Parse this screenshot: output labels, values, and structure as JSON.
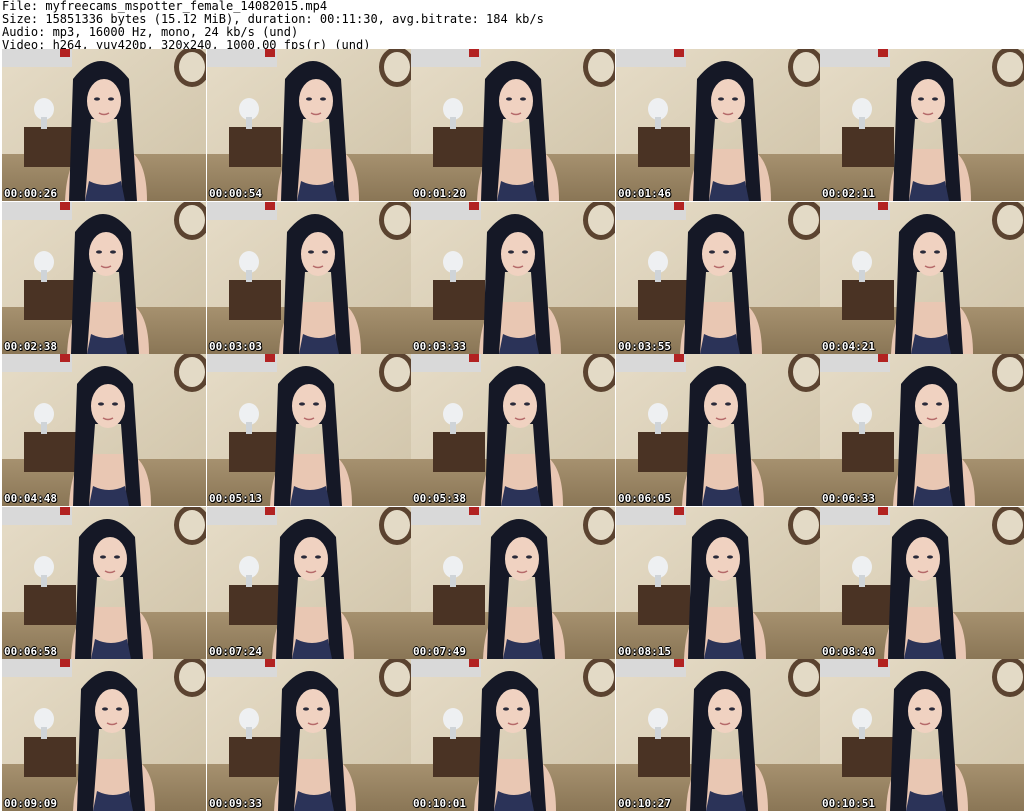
{
  "info": {
    "file": "File: myfreecams_mspotter_female_14082015.mp4",
    "size": "Size: 15851336 bytes (15.12 MiB), duration: 00:11:30, avg.bitrate: 184 kb/s",
    "audio": "Audio: mp3, 16000 Hz, mono, 24 kb/s (und)",
    "video": "Video: h264, yuv420p, 320x240, 1000.00 fps(r) (und)"
  },
  "thumbnails": [
    {
      "timestamp": "00:00:26"
    },
    {
      "timestamp": "00:00:54"
    },
    {
      "timestamp": "00:01:20"
    },
    {
      "timestamp": "00:01:46"
    },
    {
      "timestamp": "00:02:11"
    },
    {
      "timestamp": "00:02:38"
    },
    {
      "timestamp": "00:03:03"
    },
    {
      "timestamp": "00:03:33"
    },
    {
      "timestamp": "00:03:55"
    },
    {
      "timestamp": "00:04:21"
    },
    {
      "timestamp": "00:04:48"
    },
    {
      "timestamp": "00:05:13"
    },
    {
      "timestamp": "00:05:38"
    },
    {
      "timestamp": "00:06:05"
    },
    {
      "timestamp": "00:06:33"
    },
    {
      "timestamp": "00:06:58"
    },
    {
      "timestamp": "00:07:24"
    },
    {
      "timestamp": "00:07:49"
    },
    {
      "timestamp": "00:08:15"
    },
    {
      "timestamp": "00:08:40"
    },
    {
      "timestamp": "00:09:09"
    },
    {
      "timestamp": "00:09:33"
    },
    {
      "timestamp": "00:10:01"
    },
    {
      "timestamp": "00:10:27"
    },
    {
      "timestamp": "00:10:51"
    }
  ]
}
